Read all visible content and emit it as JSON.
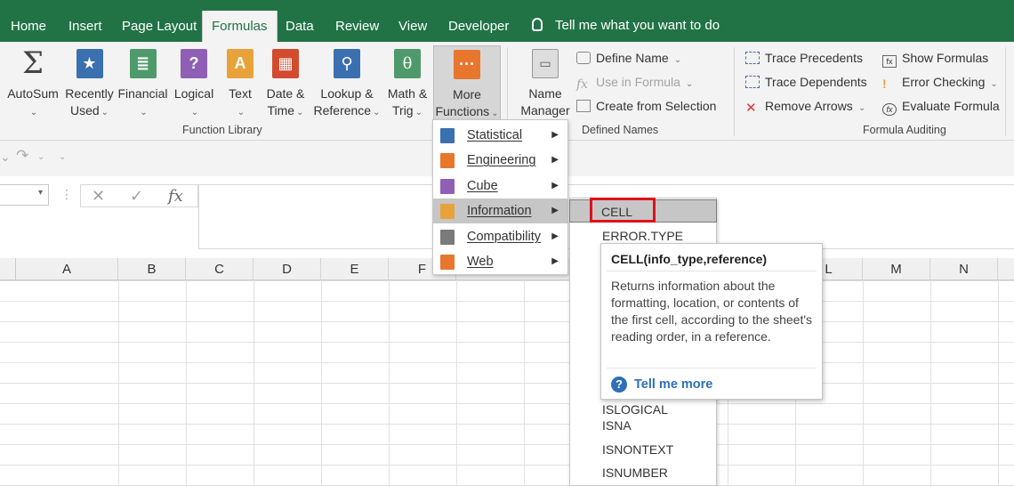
{
  "tabs": [
    "Home",
    "Insert",
    "Page Layout",
    "Formulas",
    "Data",
    "Review",
    "View",
    "Developer"
  ],
  "tell_me": "Tell me what you want to do",
  "ribbon": {
    "autosum": "AutoSum",
    "recently_used": [
      "Recently",
      "Used"
    ],
    "financial": "Financial",
    "logical": "Logical",
    "text": "Text",
    "date_time": [
      "Date &",
      "Time"
    ],
    "lookup_reference": [
      "Lookup &",
      "Reference"
    ],
    "math_trig": [
      "Math &",
      "Trig"
    ],
    "more_functions": [
      "More",
      "Functions"
    ],
    "function_library_label": "Function Library",
    "name_manager": [
      "Name",
      "Manager"
    ],
    "define_name": "Define Name",
    "use_in_formula": "Use in Formula",
    "create_from_selection": "Create from Selection",
    "defined_names_label": "Defined Names",
    "trace_precedents": "Trace Precedents",
    "trace_dependents": "Trace Dependents",
    "remove_arrows": "Remove Arrows",
    "show_formulas": "Show Formulas",
    "error_checking": "Error Checking",
    "evaluate_formula": "Evaluate Formula",
    "formula_auditing_label": "Formula Auditing"
  },
  "formula_bar": {
    "fx": "fx"
  },
  "columns": [
    "A",
    "B",
    "C",
    "D",
    "E",
    "F",
    "L",
    "M",
    "N"
  ],
  "more_menu": [
    "Statistical",
    "Engineering",
    "Cube",
    "Information",
    "Compatibility",
    "Web"
  ],
  "info_submenu": [
    "CELL",
    "ERROR.TYPE",
    "ISLOGICAL",
    "ISNA",
    "ISNONTEXT",
    "ISNUMBER"
  ],
  "tooltip": {
    "title": "CELL(info_type,reference)",
    "body": "Returns information about the formatting, location, or contents of the first cell, according to the sheet's reading order, in a reference.",
    "more": "Tell me more"
  },
  "colors": {
    "excel_green": "#217346",
    "highlight_red": "#e0111a",
    "link_blue": "#2e6fb6"
  }
}
